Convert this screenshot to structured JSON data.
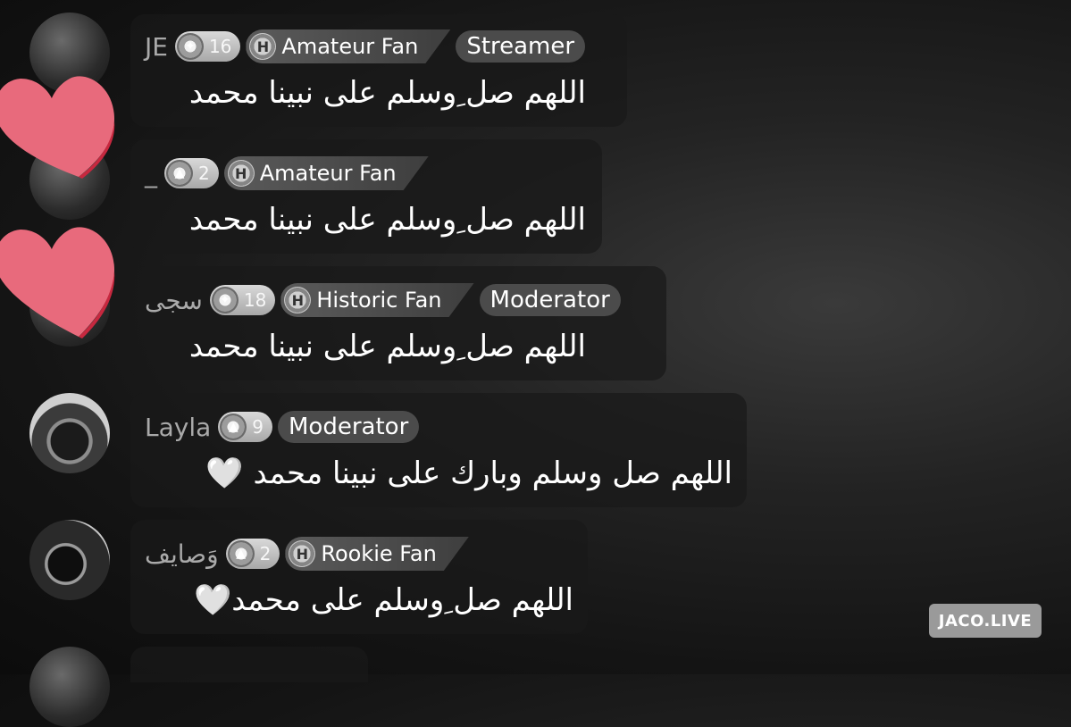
{
  "messages": [
    {
      "username": "JE",
      "level": "16",
      "fan_badge": "Amateur Fan",
      "role": "Streamer",
      "text": "اللهم صل ِوسلم على نبينا محمد"
    },
    {
      "username": "_",
      "level": "2",
      "fan_badge": "Amateur Fan",
      "role": "",
      "text": "اللهم صل ِوسلم على نبينا محمد"
    },
    {
      "username": "سجى",
      "level": "18",
      "fan_badge": "Historic Fan",
      "role": "Moderator",
      "text": "اللهم صل ِوسلم على نبينا محمد"
    },
    {
      "username": "Layla",
      "level": "9",
      "fan_badge": "",
      "role": "Moderator",
      "text": "اللهم صل وسلم وبارك على نبينا محمد",
      "emoji": "🤍"
    },
    {
      "username": "وَصايف",
      "level": "2",
      "fan_badge": "Rookie Fan",
      "role": "",
      "text": "اللهم صل ِوسلم على محمد",
      "emoji": "🤍"
    }
  ],
  "watermark": "JACO.LIVE",
  "colors": {
    "heart": "#e86a7c",
    "bubble": "#191919",
    "role_bg": "#4b4b4b"
  },
  "icons": {
    "level": "gem-icon",
    "fan": "fan-shield-icon",
    "heart": "heart-icon"
  }
}
